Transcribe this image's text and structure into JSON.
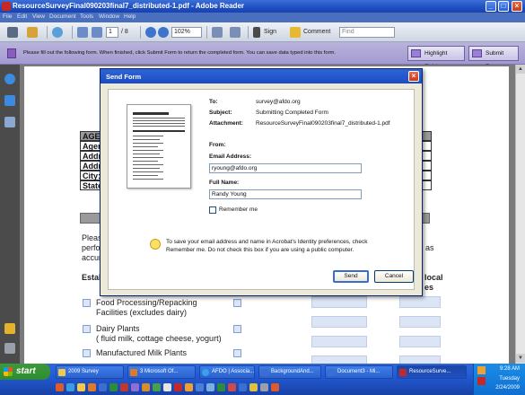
{
  "window": {
    "title": "ResourceSurveyFinal090203final7_distributed-1.pdf - Adobe Reader",
    "buttons": [
      "_",
      "□",
      "×"
    ]
  },
  "menubar": [
    "File",
    "Edit",
    "View",
    "Document",
    "Tools",
    "Window",
    "Help"
  ],
  "toolbar": {
    "page_current": "1",
    "page_total": "/ 8",
    "zoom": "102%",
    "sign_label": "Sign",
    "comment_label": "Comment",
    "find_placeholder": "Find"
  },
  "formbar": {
    "message": "Please fill out the following form. When finished, click Submit Form to return the completed form. You can save data typed into this form.",
    "highlight_label": "Highlight Fields",
    "submit_label": "Submit Form"
  },
  "document": {
    "age_header": "AGE",
    "age_rows": [
      "Agen",
      "Addr",
      "Addr",
      "City:",
      "State"
    ],
    "please_lines": [
      "Pleas",
      "perfo",
      "accur"
    ],
    "as_text": "as",
    "estab_text": "Estab",
    "local_lines": [
      "local",
      "es"
    ],
    "items": [
      [
        "Food Processing/Repacking",
        "Facilities (excludes dairy)"
      ],
      [
        "Dairy Plants",
        "( fluid milk, cottage cheese, yogurt)"
      ],
      [
        "Manufactured Milk Plants"
      ]
    ]
  },
  "dialog": {
    "title": "Send Form",
    "to_label": "To:",
    "to_value": "survey@afdo.org",
    "subject_label": "Subject:",
    "subject_value": "Submitting Completed Form",
    "attachment_label": "Attachment:",
    "attachment_value": "ResourceSurveyFinal090203final7_distributed-1.pdf",
    "from_label": "From:",
    "email_label": "Email Address:",
    "email_value": "ryoung@afdo.org",
    "name_label": "Full Name:",
    "name_value": "Randy Young",
    "remember_label": "Remember me",
    "info_line1": "To save your email address and name in Acrobat's Identity preferences, check",
    "info_line2": "Remember me. Do not check this box if you are using a public computer.",
    "send_label": "Send",
    "cancel_label": "Cancel"
  },
  "taskbar": {
    "start_label": "start",
    "tasks": [
      "2009 Survey",
      "3 Microsoft Of...",
      "AFDO | Associa...",
      "BackgroundAnd...",
      "Document3 - Mi...",
      "ResourceSurve..."
    ],
    "time": "9:28 AM",
    "day": "Tuesday",
    "date": "2/24/2009"
  },
  "colors": {
    "title_blue": "#1f4fc0",
    "form_bar": "#a39bd0",
    "field_fill": "#dbe5f5",
    "start_green": "#2f8b2f"
  }
}
